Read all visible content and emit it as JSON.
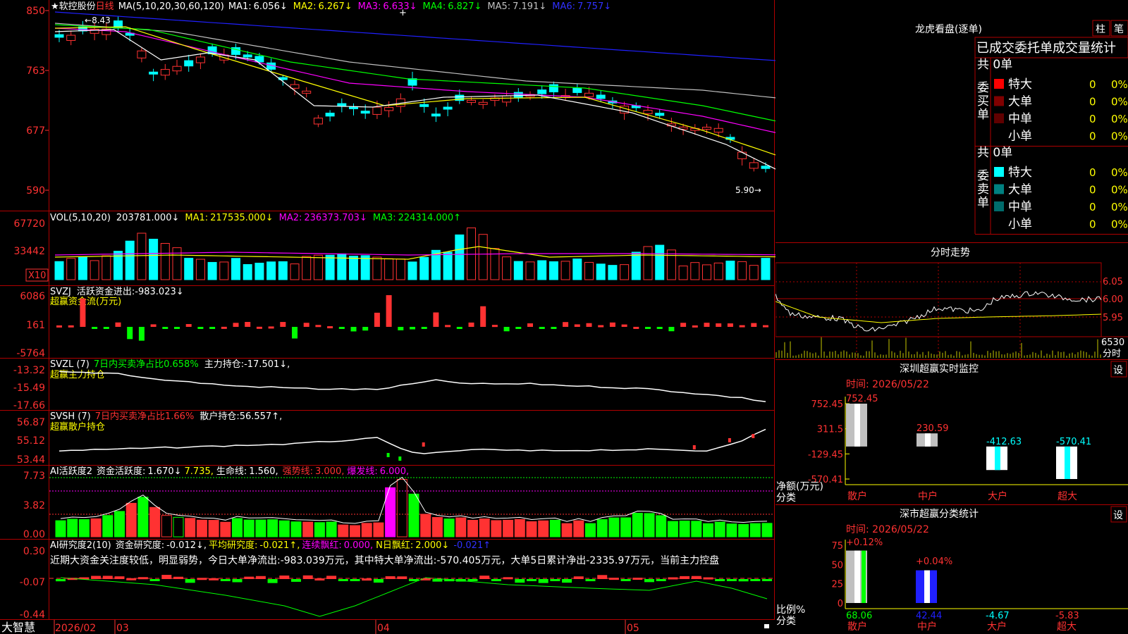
{
  "colors": {
    "up": "#ff3232",
    "down": "#00ffff",
    "ma1": "#ffffff",
    "ma2": "#ffff00",
    "ma3": "#ff00ff",
    "ma4": "#00ff00",
    "ma5": "#c0c0c0",
    "ma6": "#2020ff",
    "grid": "#b00000",
    "axis": "#ff3232",
    "green": "#00ff00",
    "yellow": "#ffff00",
    "magenta": "#ff00ff"
  },
  "header": {
    "star": "★",
    "stock_name": "软控股份",
    "period": "日线",
    "ma_prefix": "MA(5,10,20,30,60,120)",
    "ma": [
      {
        "label": "MA1:",
        "value": "6.056↓"
      },
      {
        "label": "MA2:",
        "value": "6.267↓"
      },
      {
        "label": "MA3:",
        "value": "6.633↓"
      },
      {
        "label": "MA4:",
        "value": "6.827↓"
      },
      {
        "label": "MA5:",
        "value": "7.191↓"
      },
      {
        "label": "MA6:",
        "value": "7.757↓"
      }
    ]
  },
  "price_axis": [
    "850",
    "763",
    "677",
    "590"
  ],
  "price_annotations": {
    "high": "8.43",
    "low": "5.90"
  },
  "vol": {
    "title": "VOL(5,10,20)",
    "value": "203781.000↓",
    "ma": [
      {
        "label": "MA1:",
        "value": "217535.000↓"
      },
      {
        "label": "MA2:",
        "value": "236373.703↓"
      },
      {
        "label": "MA3:",
        "value": "224314.000↑"
      }
    ],
    "axis": [
      "67720",
      "33442"
    ],
    "unit": "X10"
  },
  "svzj": {
    "title": "SVZJ",
    "name": "活跃资金进出:",
    "value": "-983.023↓",
    "subtitle": "超赢资金流(万元)",
    "axis": [
      "6086",
      "161",
      "-5764"
    ]
  },
  "svzl": {
    "title": "SVZL (7)",
    "desc": "7日内买卖净占比0.658%",
    "name": "主力持仓:",
    "value": "-17.501↓,",
    "subtitle": "超赢主力持仓",
    "axis": [
      "-13.32",
      "-15.49",
      "-17.66"
    ]
  },
  "svsh": {
    "title": "SVSH (7)",
    "desc": "7日内买卖净占比1.66%",
    "name": "散户持仓:",
    "value": "56.557↑,",
    "subtitle": "超赢散户持仓",
    "axis": [
      "56.87",
      "55.12",
      "53.44"
    ]
  },
  "active": {
    "title": "AI活跃度2",
    "name": "资金活跃度:",
    "value": "1.670↓",
    "v2": "7.735,",
    "life": "生命线:",
    "life_v": "1.560,",
    "strong": "强势线:",
    "strong_v": "3.000,",
    "burst": "爆发线:",
    "burst_v": "6.000,",
    "axis": [
      "7.73",
      "3.82",
      "0.00"
    ]
  },
  "research": {
    "title": "AI研究度2(10)",
    "name": "资金研究度:",
    "value": "-0.012↓,",
    "avg": "平均研究度:",
    "avg_v": "-0.021↑,",
    "red": "连续飘红:",
    "red_v": "0.000,",
    "nred": "N日飘红:",
    "nred_v": "2.000↓",
    "tail": "-0.021↑",
    "axis": [
      "0.30",
      "-0.07",
      "-0.44"
    ],
    "comment": "近期大资金关注度较低，明显弱势，今日大单净流出:-983.039万元，其中特大单净流出:-570.405万元，大单5日累计净出-2335.97万元，当前主力控盘"
  },
  "time_axis": {
    "brand": "大智慧",
    "labels": [
      "2026/02",
      "03",
      "04",
      "05"
    ]
  },
  "side": {
    "lhb": {
      "title": "龙虎看盘(逐单)",
      "btn1": "柱",
      "btn2": "笔",
      "table_title": "已成交委托单成交量统计",
      "buy": {
        "label": "委买单",
        "total": "共 0单",
        "rows": [
          {
            "name": "特大",
            "v": "0",
            "p": "0%"
          },
          {
            "name": "大单",
            "v": "0",
            "p": "0%"
          },
          {
            "name": "中单",
            "v": "0",
            "p": "0%"
          },
          {
            "name": "小单",
            "v": "0",
            "p": "0%"
          }
        ]
      },
      "sell": {
        "label": "委卖单",
        "total": "共 0单",
        "rows": [
          {
            "name": "特大",
            "v": "0",
            "p": "0%"
          },
          {
            "name": "大单",
            "v": "0",
            "p": "0%"
          },
          {
            "name": "中单",
            "v": "0",
            "p": "0%"
          },
          {
            "name": "小单",
            "v": "0",
            "p": "0%"
          }
        ]
      }
    },
    "intraday": {
      "title": "分时走势",
      "axis": [
        "6.05",
        "6.00",
        "5.95"
      ],
      "vol_label": "6530",
      "vol_unit": "分时"
    },
    "monitor": {
      "title": "深圳超赢实时监控",
      "btn": "设",
      "time_label": "时间: 2026/05/22",
      "axis": [
        "752.45",
        "311.5",
        "-129.45",
        "-570.41"
      ],
      "ylabel": "净额(万元)",
      "xlabel": "分类",
      "bars": [
        {
          "name": "散户",
          "value": 752.45,
          "label": "752.45"
        },
        {
          "name": "中户",
          "value": 230.59,
          "label": "230.59"
        },
        {
          "name": "大户",
          "value": -412.63,
          "label": "-412.63"
        },
        {
          "name": "超大",
          "value": -570.41,
          "label": "-570.41"
        }
      ]
    },
    "stats": {
      "title": "深市超赢分类统计",
      "btn": "设",
      "time_label": "时间: 2026/05/22",
      "axis": [
        "75",
        "50",
        "25",
        "0"
      ],
      "ylabel": "比例%",
      "xlabel": "分类",
      "top_labels": [
        "+0.12%",
        "+0.04%"
      ],
      "bars": [
        {
          "name": "散户",
          "value": 68.06,
          "label": "68.06"
        },
        {
          "name": "中户",
          "value": 42.44,
          "label": "42.44"
        },
        {
          "name": "大户",
          "value": -4.67,
          "label": "-4.67"
        },
        {
          "name": "超大",
          "value": -5.83,
          "label": "-5.83"
        }
      ]
    }
  }
}
